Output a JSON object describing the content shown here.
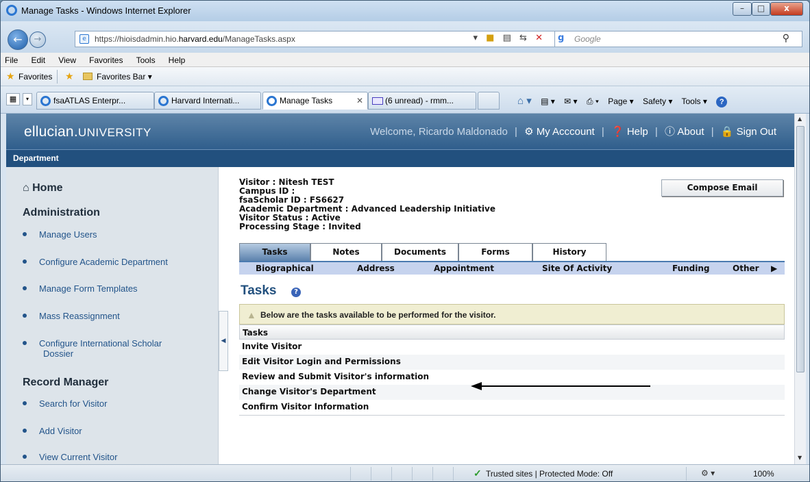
{
  "window": {
    "title": "Manage Tasks - Windows Internet Explorer",
    "minimize": "–",
    "maximize": "□",
    "close": "x"
  },
  "address": {
    "url_prefix": "https://hioisdadmin.hio.",
    "url_domain": "harvard.edu",
    "url_suffix": "/ManageTasks.aspx",
    "search_placeholder": "Google"
  },
  "menu": [
    "File",
    "Edit",
    "View",
    "Favorites",
    "Tools",
    "Help"
  ],
  "favorites": {
    "label": "Favorites",
    "bar_label": "Favorites Bar ▾"
  },
  "browser_tabs": [
    {
      "label": "fsaATLAS Enterpr..."
    },
    {
      "label": "Harvard Internati..."
    },
    {
      "label": "Manage Tasks"
    },
    {
      "label": "(6 unread) - rmm..."
    }
  ],
  "commandbar": {
    "page": "Page ▾",
    "safety": "Safety ▾",
    "tools": "Tools ▾"
  },
  "site": {
    "logo_main": "ellucian.",
    "logo_sub": "UNIVERSITY",
    "welcome": "Welcome, Ricardo Maldonado",
    "my_account": "My Acccount",
    "help": "Help",
    "about": "About",
    "sign_out": "Sign Out",
    "department": "Department"
  },
  "sidebar": {
    "home": "Home",
    "admin_heading": "Administration",
    "admin_items": [
      "Manage Users",
      "Configure Academic Department",
      "Manage Form Templates",
      "Mass Reassignment"
    ],
    "dossier_line1": "Configure International Scholar",
    "dossier_line2": "Dossier",
    "record_heading": "Record Manager",
    "record_items": [
      "Search for Visitor",
      "Add Visitor",
      "View Current Visitor"
    ]
  },
  "visitor": {
    "line1": "Visitor : Nitesh TEST",
    "line2": "Campus ID :",
    "line3": "fsaScholar ID : FS6627",
    "line4": "Academic Department : Advanced Leadership Initiative",
    "line5": "Visitor Status : Active",
    "line6": "Processing Stage : Invited"
  },
  "compose_email": "Compose Email",
  "tabs": [
    "Tasks",
    "Notes",
    "Documents",
    "Forms",
    "History"
  ],
  "subtabs": [
    "Biographical",
    "Address",
    "Appointment",
    "Site Of Activity",
    "Funding",
    "Other"
  ],
  "tasks_title": "Tasks",
  "info_message": "Below are the tasks available to be performed for the visitor.",
  "task_table": {
    "header": "Tasks",
    "rows": [
      "Invite Visitor",
      "Edit Visitor Login and Permissions",
      "Review and Submit Visitor's information",
      "Change Visitor's Department",
      "Confirm Visitor Information"
    ]
  },
  "status": {
    "zone": "Trusted sites | Protected Mode: Off",
    "zoom": "100%"
  }
}
